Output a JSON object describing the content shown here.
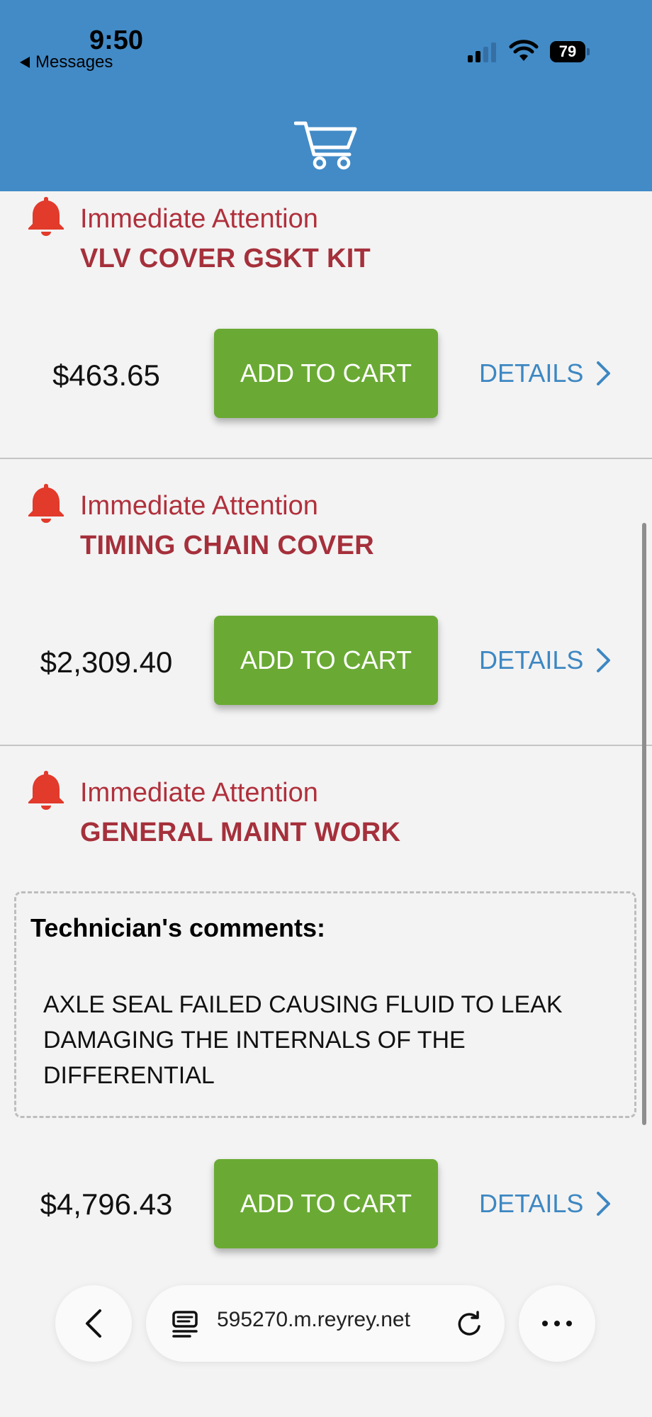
{
  "status_bar": {
    "time": "9:50",
    "back_label": "Messages",
    "battery": "79"
  },
  "header": {
    "icon": "shopping-cart-icon"
  },
  "items": [
    {
      "attention": "Immediate Attention",
      "title": "VLV COVER GSKT KIT",
      "price": "$463.65",
      "add_label": "ADD TO CART",
      "details_label": "DETAILS"
    },
    {
      "attention": "Immediate Attention",
      "title": "TIMING CHAIN COVER",
      "price": "$2,309.40",
      "add_label": "ADD TO CART",
      "details_label": "DETAILS"
    },
    {
      "attention": "Immediate Attention",
      "title": "GENERAL MAINT WORK",
      "comments_heading": "Technician's comments:",
      "comments": "AXLE SEAL FAILED CAUSING FLUID TO LEAK DAMAGING THE INTERNALS OF THE DIFFERENTIAL",
      "price": "$4,796.43",
      "add_label": "ADD TO CART",
      "details_label": "DETAILS"
    }
  ],
  "browser": {
    "url": "595270.m.reyrey.net"
  },
  "colors": {
    "header": "#428bc7",
    "attention": "#b0303c",
    "add_button": "#6aaa34",
    "details_link": "#3d87c2"
  }
}
